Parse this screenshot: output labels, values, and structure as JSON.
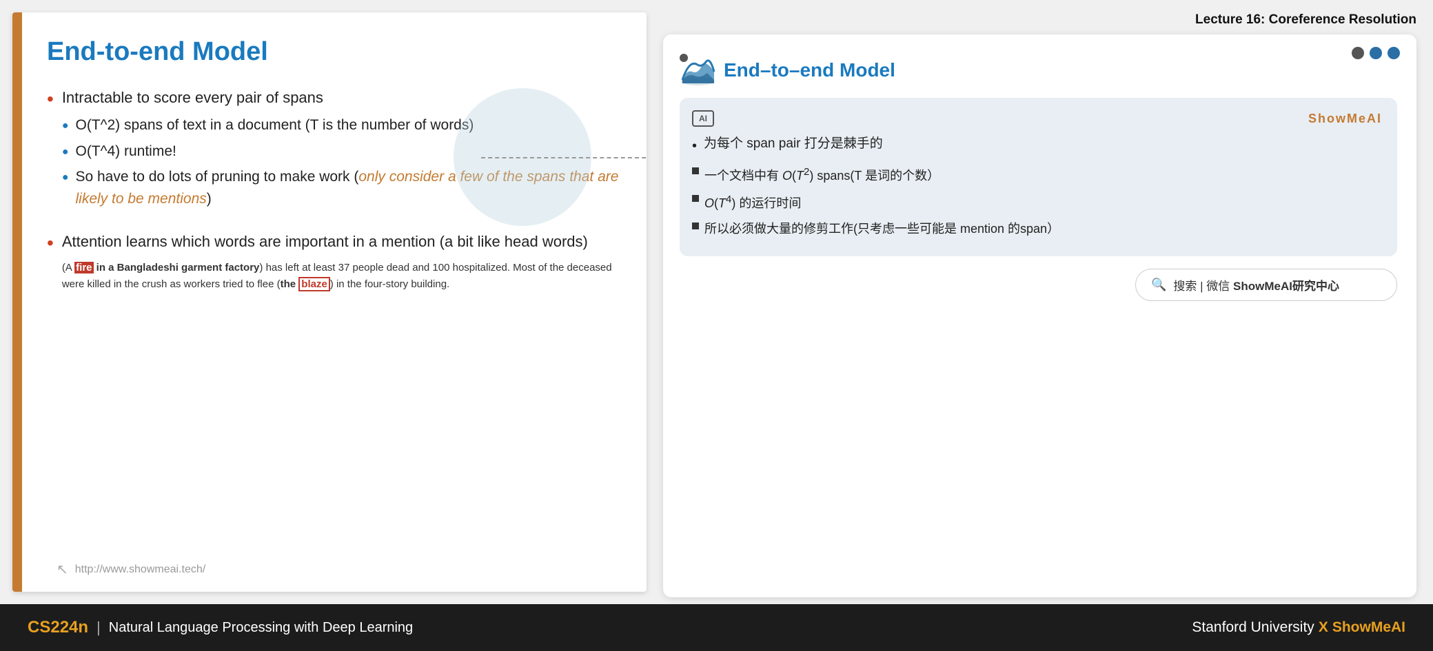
{
  "lecture": {
    "title": "Lecture 16: Coreference Resolution"
  },
  "slide": {
    "title": "End-to-end Model",
    "bullets": [
      {
        "text": "Intractable to score every pair of spans",
        "sub": [
          "O(T^2) spans of text in a document (T is the number of words)",
          "O(T^4) runtime!",
          "So have to do lots of pruning to make work (only consider a few of the spans that are likely to be mentions)"
        ]
      },
      {
        "text": "Attention learns which words are important in a mention (a bit like head words)"
      }
    ],
    "example_prefix": "(A ",
    "fire_word": "fire",
    "example_mid1": " in a Bangladeshi garment factory)",
    "example_mid2": " has left at least 37 people dead and 100 hospitalized. Most of the deceased were killed in the crush as workers tried to flee (",
    "the_word": "the ",
    "blaze_word": "blaze",
    "example_end": ") in the four-story building.",
    "footer_url": "http://www.showmeai.tech/"
  },
  "right_card": {
    "title": "End–to–end Model",
    "ai_label": "ShowMeAI",
    "ai_icon_text": "AI",
    "bullet_main": "为每个 span pair 打分是棘手的",
    "sub_bullets": [
      "一个文档中有 O(T²) spans(T 是词的个数）",
      "O(T⁴) 的运行时间",
      "所以必须做大量的修剪工作(只考虑一些可能是 mention 的span）"
    ]
  },
  "search": {
    "text": "搜索 | 微信 ShowMeAI研究中心"
  },
  "bottom_bar": {
    "course_code": "CS224n",
    "divider": "|",
    "course_name": "Natural Language Processing with Deep Learning",
    "right_text": "Stanford University",
    "x_mark": "X",
    "brand": "ShowMeAI"
  },
  "dots": {
    "dark1": "#555",
    "dark2": "#2a6ea6",
    "dark3": "#2a6ea6"
  }
}
